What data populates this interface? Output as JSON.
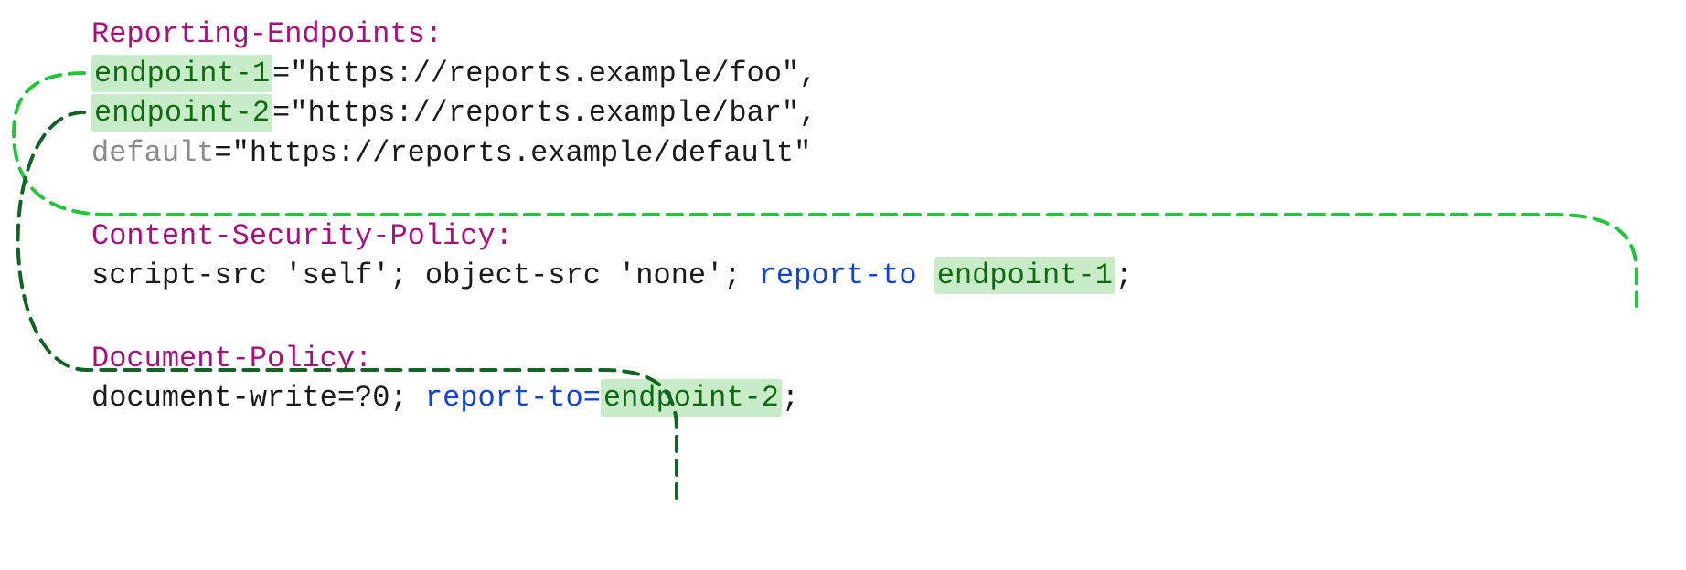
{
  "blocks": {
    "reporting": {
      "header": "Reporting-Endpoints:",
      "endpoint1_key": "endpoint-1",
      "endpoint1_rest": "=\"https://reports.example/foo\",",
      "endpoint2_key": "endpoint-2",
      "endpoint2_rest": "=\"https://reports.example/bar\",",
      "default_key": "default",
      "default_rest": "=\"https://reports.example/default\""
    },
    "csp": {
      "header": "Content-Security-Policy:",
      "body_pre": "script-src 'self'; object-src 'none'; ",
      "directive": "report-to ",
      "endpoint": "endpoint-1",
      "body_post": ";"
    },
    "docpolicy": {
      "header": "Document-Policy:",
      "body_pre": "document-write=?0; ",
      "directive": "report-to=",
      "endpoint": "endpoint-2",
      "body_post": ";"
    }
  }
}
